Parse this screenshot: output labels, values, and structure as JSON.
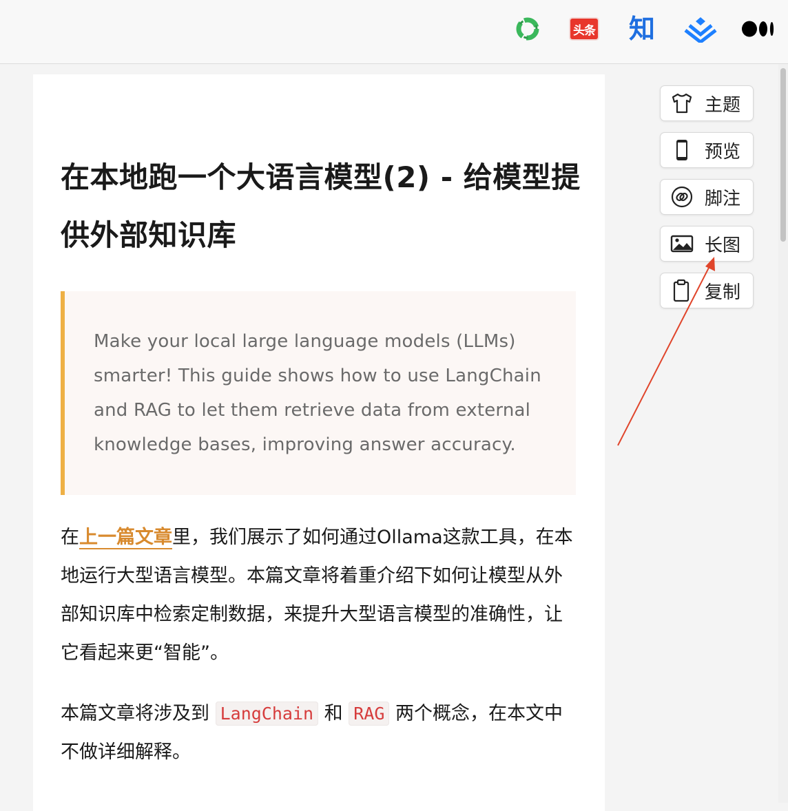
{
  "toolbar": {
    "icons": [
      {
        "name": "wechat-icon",
        "color": "#3bb85c"
      },
      {
        "name": "toutiao-icon",
        "label": "头条",
        "color": "#e8362b"
      },
      {
        "name": "zhihu-icon",
        "label": "知",
        "color": "#1f6fe0"
      },
      {
        "name": "juejin-icon",
        "color": "#1e80ff"
      },
      {
        "name": "medium-icon",
        "color": "#000000"
      }
    ]
  },
  "article": {
    "title": "在本地跑一个大语言模型(2) - 给模型提供外部知识库",
    "quote": "Make your local large language models (LLMs) smarter! This guide shows how to use LangChain and RAG to let them retrieve data from external knowledge bases, improving answer accuracy.",
    "p1": {
      "before": "在",
      "link": "上一篇文章",
      "after": "里，我们展示了如何通过Ollama这款工具，在本地运行大型语言模型。本篇文章将着重介绍下如何让模型从外部知识库中检索定制数据，来提升大型语言模型的准确性，让它看起来更“智能”。"
    },
    "p2": {
      "before": "本篇文章将涉及到 ",
      "code1": "LangChain",
      "middle": " 和 ",
      "code2": "RAG",
      "after": " 两个概念，在本文中不做详细解释。"
    },
    "accent_color": "#eeb045",
    "link_color": "#d88a2e",
    "code_color": "#d63c3c"
  },
  "side_buttons": [
    {
      "label": "主题",
      "icon": "tshirt-icon"
    },
    {
      "label": "预览",
      "icon": "phone-icon"
    },
    {
      "label": "脚注",
      "icon": "link-icon"
    },
    {
      "label": "长图",
      "icon": "image-icon"
    },
    {
      "label": "复制",
      "icon": "clipboard-icon"
    }
  ],
  "annotation": {
    "color": "#e0452b"
  }
}
